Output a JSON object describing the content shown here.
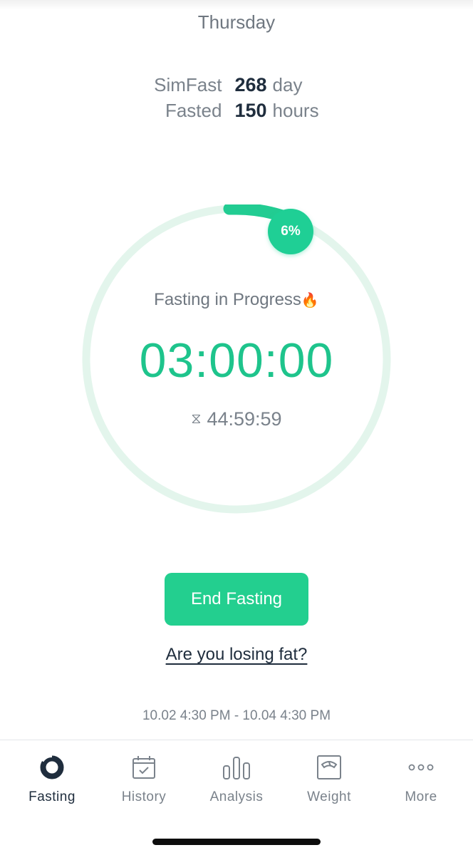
{
  "header": {
    "day": "Thursday"
  },
  "stats": {
    "streak": {
      "label": "SimFast",
      "value": "268",
      "unit": "day"
    },
    "fasted": {
      "label": "Fasted",
      "value": "150",
      "unit": "hours"
    }
  },
  "progress": {
    "percent_label": "6%",
    "fraction": 0.06,
    "status": "Fasting in Progress",
    "status_emoji": "🔥",
    "elapsed": "03:00:00",
    "remaining": "44:59:59",
    "remaining_icon": "hourglass-icon"
  },
  "actions": {
    "end_label": "End Fasting",
    "fat_link": "Are you losing fat?"
  },
  "period": "10.02 4:30 PM - 10.04 4:30 PM",
  "tabbar": {
    "items": [
      {
        "label": "Fasting",
        "icon": "fasting-ring-icon",
        "active": true
      },
      {
        "label": "History",
        "icon": "calendar-check-icon",
        "active": false
      },
      {
        "label": "Analysis",
        "icon": "bar-chart-icon",
        "active": false
      },
      {
        "label": "Weight",
        "icon": "scale-icon",
        "active": false
      },
      {
        "label": "More",
        "icon": "more-dots-icon",
        "active": false
      }
    ]
  },
  "colors": {
    "accent": "#1ec48c",
    "button": "#23cf8f",
    "ring_track": "#e3f5ec",
    "text_dark": "#1f2d3d",
    "text_muted": "#7a828b"
  }
}
